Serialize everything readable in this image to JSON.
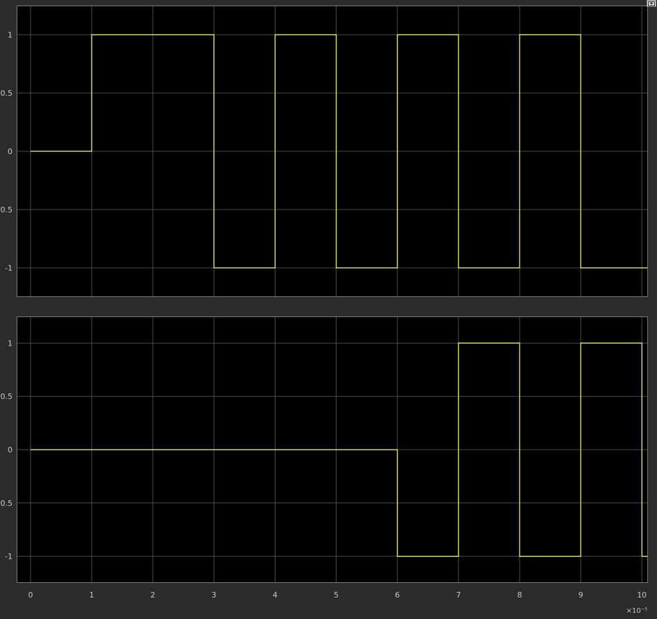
{
  "colors": {
    "figure_background": "#2b2b2b",
    "axes_background": "#000000",
    "grid": "#4a4a4a",
    "axes_border": "#7a7a7a",
    "tick_label": "#c8c8c8",
    "signal": "#ffff66"
  },
  "toolbar": {
    "undock_icon": "undock-icon"
  },
  "chart_data": [
    {
      "type": "line",
      "step": true,
      "title": "",
      "xlabel": "",
      "ylabel": "",
      "x_exponent_label": "",
      "xlim": [
        0,
        10.1
      ],
      "ylim": [
        -1.25,
        1.25
      ],
      "xticks": [
        0,
        1,
        2,
        3,
        4,
        5,
        6,
        7,
        8,
        9,
        10
      ],
      "yticks": [
        1,
        0.5,
        0,
        -0.5,
        -1
      ],
      "ytick_labels": [
        "1",
        "0.5",
        "0",
        "-0.5",
        "-1"
      ],
      "grid": true,
      "legend": "none",
      "series": [
        {
          "x": [
            0,
            1,
            1,
            3,
            3,
            4,
            4,
            5,
            5,
            6,
            6,
            7,
            7,
            8,
            8,
            9,
            9,
            10.1
          ],
          "y": [
            0,
            0,
            1,
            1,
            -1,
            -1,
            1,
            1,
            -1,
            -1,
            1,
            1,
            -1,
            -1,
            1,
            1,
            -1,
            -1
          ]
        }
      ]
    },
    {
      "type": "line",
      "step": true,
      "title": "",
      "xlabel": "",
      "ylabel": "",
      "x_exponent_label": "×10⁻⁵",
      "xlim": [
        0,
        10.1
      ],
      "ylim": [
        -1.25,
        1.25
      ],
      "xticks": [
        0,
        1,
        2,
        3,
        4,
        5,
        6,
        7,
        8,
        9,
        10
      ],
      "xtick_labels": [
        "0",
        "1",
        "2",
        "3",
        "4",
        "5",
        "6",
        "7",
        "8",
        "9",
        "10"
      ],
      "yticks": [
        1,
        0.5,
        0,
        -0.5,
        -1
      ],
      "ytick_labels": [
        "1",
        "0.5",
        "0",
        "-0.5",
        "-1"
      ],
      "grid": true,
      "legend": "none",
      "series": [
        {
          "x": [
            0,
            6,
            6,
            7,
            7,
            8,
            8,
            9,
            9,
            10,
            10,
            10.1
          ],
          "y": [
            0,
            0,
            -1,
            -1,
            1,
            1,
            -1,
            -1,
            1,
            1,
            -1,
            -1
          ]
        }
      ]
    }
  ]
}
